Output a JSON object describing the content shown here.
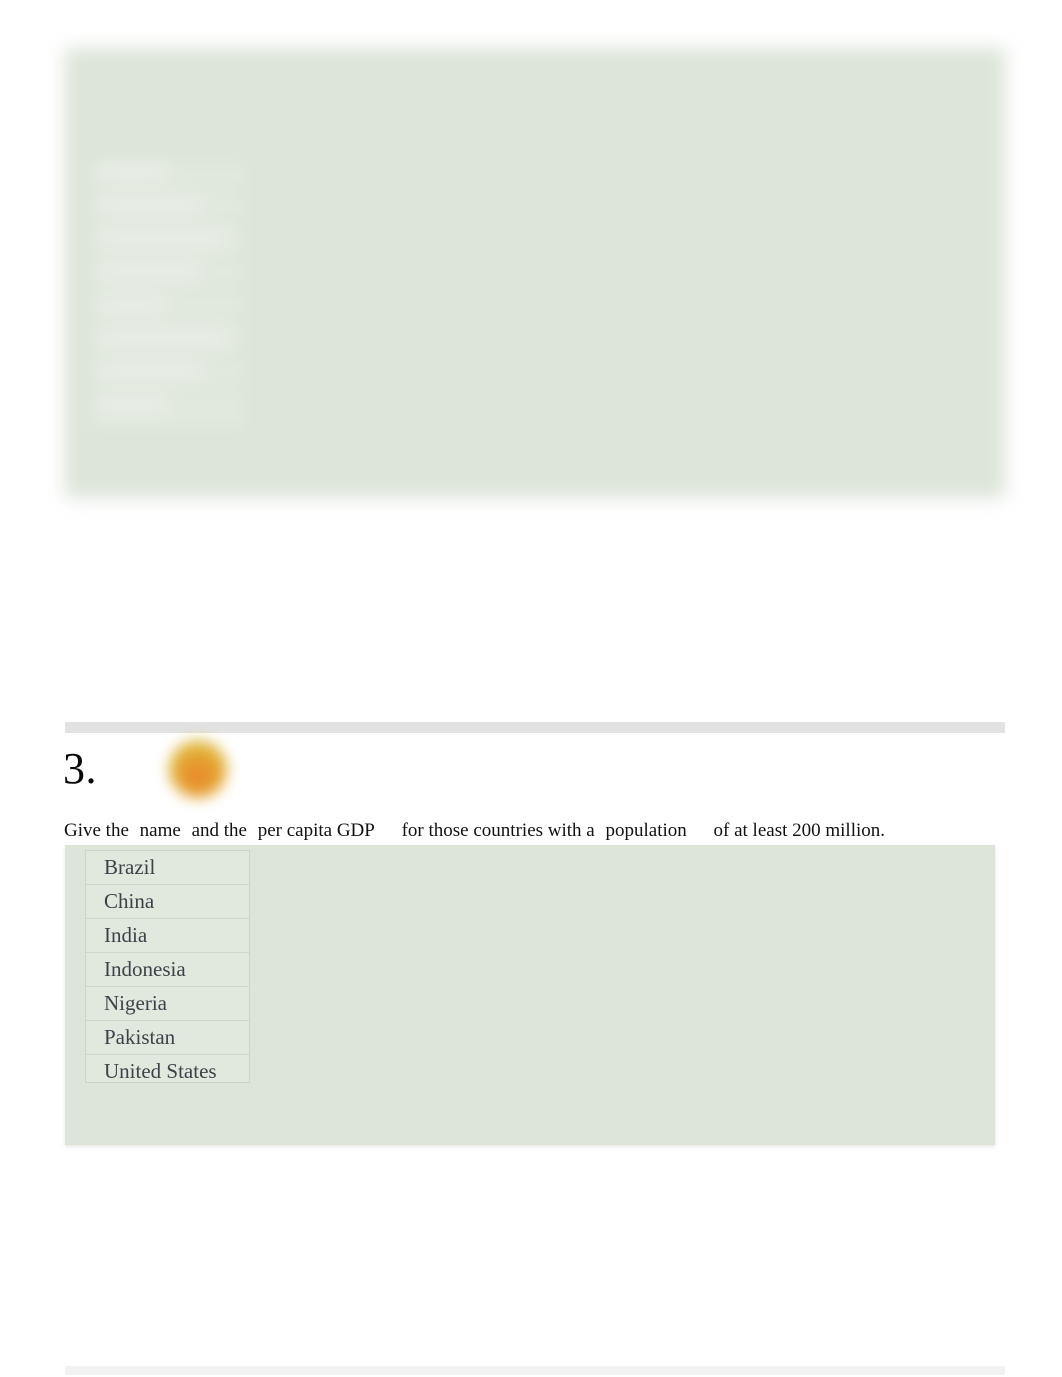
{
  "page": {
    "background_color": "#ffffff",
    "panel_color": "#dce5d8",
    "text_color": "#3b434a",
    "separator_color": "#e2e2e2",
    "badge_color": "#e8952e"
  },
  "question_2": {
    "panel_label": "answer panel",
    "result_box_label": "result list",
    "blurred": true,
    "ghost_row_count": 8
  },
  "question_3": {
    "number": "3.",
    "badge_icon": "award-badge-icon",
    "prompt": {
      "segment_1": "Give the",
      "term_1": "name",
      "segment_2": "and the",
      "term_2": "per capita GDP",
      "segment_3": "for those countries with a",
      "term_3": "population",
      "segment_4": "of at least 200 million."
    },
    "result_columns": [
      "name"
    ],
    "results": [
      {
        "name": "Brazil"
      },
      {
        "name": "China"
      },
      {
        "name": "India"
      },
      {
        "name": "Indonesia"
      },
      {
        "name": "Nigeria"
      },
      {
        "name": "Pakistan"
      },
      {
        "name": "United States"
      }
    ]
  }
}
